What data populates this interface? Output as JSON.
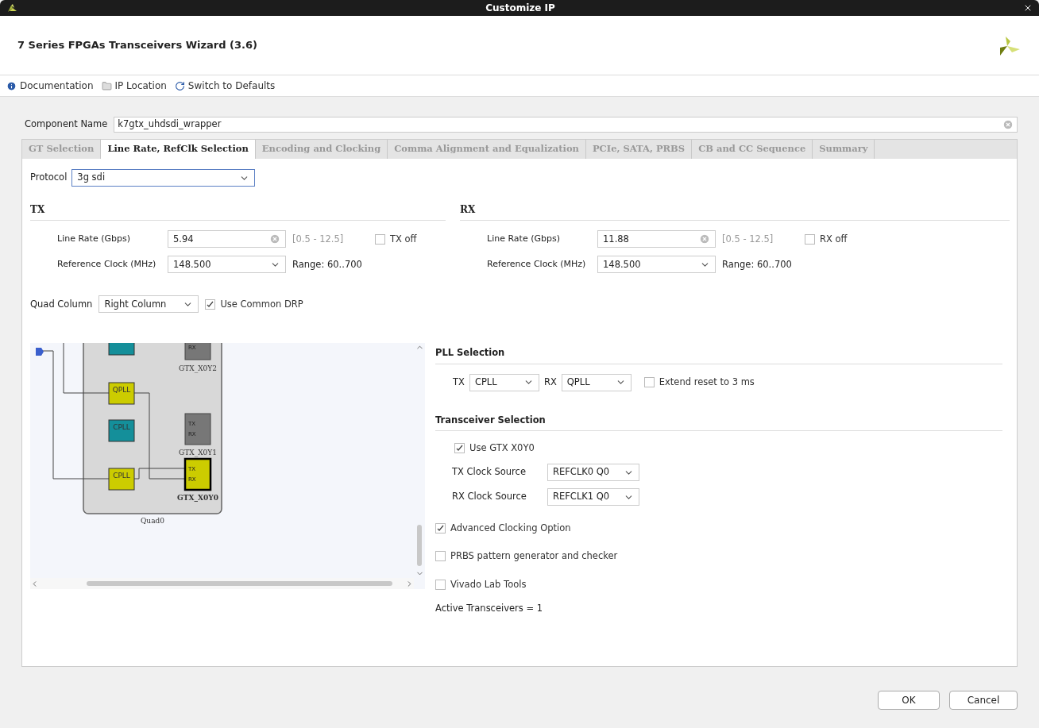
{
  "window": {
    "title": "Customize IP"
  },
  "header": {
    "title": "7 Series FPGAs Transceivers Wizard (3.6)"
  },
  "toolbar": [
    {
      "kind": "info",
      "label": "Documentation"
    },
    {
      "kind": "folder",
      "label": "IP Location"
    },
    {
      "kind": "refresh",
      "label": "Switch to Defaults"
    }
  ],
  "component_name": {
    "label": "Component Name",
    "value": "k7gtx_uhdsdi_wrapper"
  },
  "tabs": [
    {
      "label": "GT Selection",
      "selected": false
    },
    {
      "label": "Line Rate, RefClk Selection",
      "selected": true
    },
    {
      "label": "Encoding and Clocking",
      "selected": false
    },
    {
      "label": "Comma Alignment and Equalization",
      "selected": false
    },
    {
      "label": "PCIe, SATA, PRBS",
      "selected": false
    },
    {
      "label": "CB and CC Sequence",
      "selected": false
    },
    {
      "label": "Summary",
      "selected": false
    }
  ],
  "protocol": {
    "label": "Protocol",
    "value": "3g sdi"
  },
  "sides": [
    {
      "title": "TX",
      "line_rate": {
        "label": "Line Rate (Gbps)",
        "value": "5.94",
        "range": "[0.5 - 12.5]"
      },
      "off": {
        "label": "TX off",
        "checked": false
      },
      "ref_clock": {
        "label": "Reference Clock (MHz)",
        "value": "148.500",
        "range": "Range: 60..700"
      }
    },
    {
      "title": "RX",
      "line_rate": {
        "label": "Line Rate (Gbps)",
        "value": "11.88",
        "range": "[0.5 - 12.5]"
      },
      "off": {
        "label": "RX off",
        "checked": false
      },
      "ref_clock": {
        "label": "Reference Clock (MHz)",
        "value": "148.500",
        "range": "Range: 60..700"
      }
    }
  ],
  "quad_column": {
    "label": "Quad Column",
    "value": "Right Column"
  },
  "use_common_drp": {
    "label": "Use Common DRP",
    "checked": true
  },
  "diagram": {
    "quad_label": "Quad0",
    "plls": [
      {
        "label": "QPLL",
        "active": true
      },
      {
        "label": "CPLL",
        "active": false
      },
      {
        "label": "CPLL",
        "active": true
      }
    ],
    "transceivers": [
      {
        "name": "GTX_X0Y2",
        "ports": [
          "RX"
        ],
        "active": false
      },
      {
        "name": "GTX_X0Y1",
        "ports": [
          "TX",
          "RX"
        ],
        "active": false
      },
      {
        "name": "GTX_X0Y0",
        "ports": [
          "TX",
          "RX"
        ],
        "active": true
      }
    ]
  },
  "pll_selection": {
    "title": "PLL Selection",
    "tx_label": "TX",
    "tx_value": "CPLL",
    "rx_label": "RX",
    "rx_value": "QPLL",
    "extend_reset": {
      "label": "Extend reset to 3 ms",
      "checked": false
    }
  },
  "transceiver_selection": {
    "title": "Transceiver Selection",
    "use_gtx": {
      "label": "Use GTX X0Y0",
      "checked": true
    },
    "clock_sources": [
      {
        "label": "TX Clock Source",
        "value": "REFCLK0 Q0"
      },
      {
        "label": "RX Clock Source",
        "value": "REFCLK1 Q0"
      }
    ]
  },
  "options": [
    {
      "label": "Advanced Clocking Option",
      "checked": true
    },
    {
      "label": "PRBS pattern generator and checker",
      "checked": false
    },
    {
      "label": "Vivado Lab Tools",
      "checked": false
    }
  ],
  "active_transceivers": "Active Transceivers = 1",
  "buttons": [
    "OK",
    "Cancel"
  ]
}
